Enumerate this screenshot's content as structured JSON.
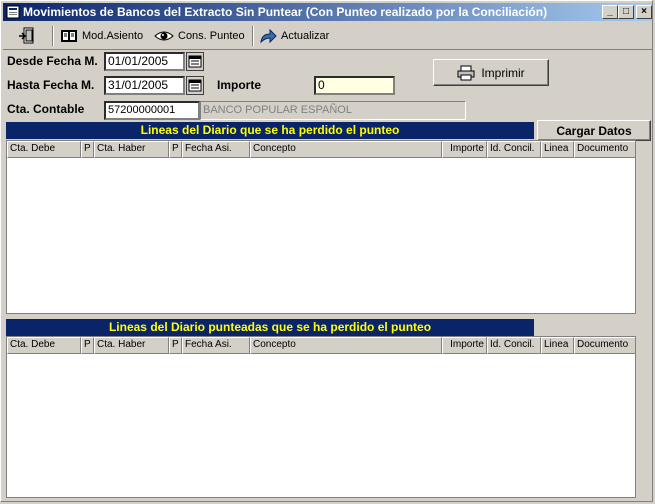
{
  "window": {
    "title": "Movimientos de Bancos del Extracto Sin Puntear (Con Punteo realizado por la Conciliación)",
    "minimize": "_",
    "maximize": "□",
    "close": "×"
  },
  "toolbar": {
    "mod_asiento": "Mod.Asiento",
    "cons_punteo": "Cons. Punteo",
    "actualizar": "Actualizar"
  },
  "filters": {
    "desde_label": "Desde Fecha M.",
    "desde_value": "01/01/2005",
    "hasta_label": "Hasta Fecha M.",
    "hasta_value": "31/01/2005",
    "importe_label": "Importe",
    "importe_value": "0",
    "cta_label": "Cta. Contable",
    "cta_value": "57200000001",
    "cta_desc": "BANCO POPULAR ESPAÑOL"
  },
  "buttons": {
    "imprimir": "Imprimir",
    "cargar_datos": "Cargar Datos"
  },
  "grid1": {
    "title": "Lineas del Diario que se ha perdido el punteo"
  },
  "grid2": {
    "title": "Lineas del Diario punteadas que se ha perdido el punteo"
  },
  "columns": [
    "Cta. Debe",
    "P",
    "Cta. Haber",
    "P",
    "Fecha Asi.",
    "Concepto",
    "Importe",
    "Id. Concil.",
    "Linea",
    "Documento"
  ],
  "colors": {
    "section_bg": "#0a246a",
    "section_text": "#ffff00",
    "title_gradient_start": "#0a246a",
    "title_gradient_end": "#a6caf0"
  }
}
